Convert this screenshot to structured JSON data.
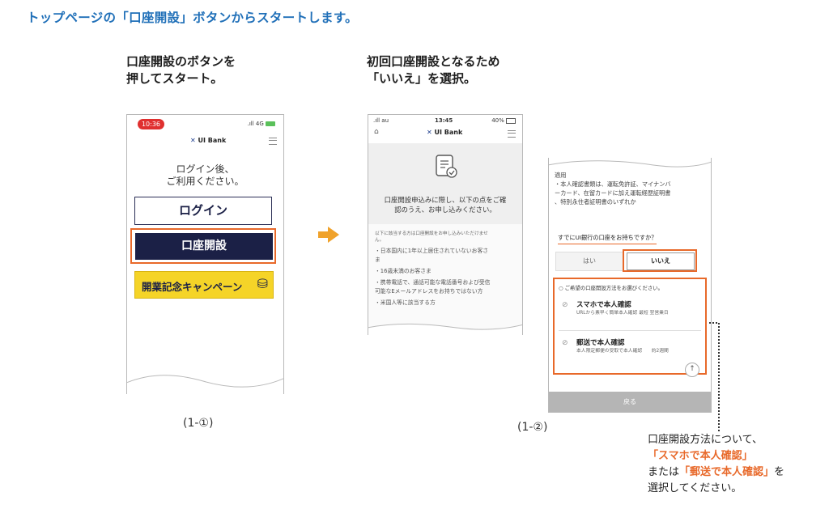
{
  "heading": "トップページの「口座開設」ボタンからスタートします。",
  "step1": {
    "caption_line1": "口座開設のボタンを",
    "caption_line2": "押してスタート。",
    "label": "(1-①)",
    "phone": {
      "time": "10:36",
      "signal": ".ıll 4G",
      "brand": "UI Bank",
      "greeting_line1": "ログイン後、",
      "greeting_line2": "ご利用ください。",
      "login_label": "ログイン",
      "open_account_label": "口座開設",
      "campaign_label": "開業記念キャンペーン"
    }
  },
  "step2": {
    "caption_line1": "初回口座開設となるため",
    "caption_line2": "「いいえ」を選択。",
    "label": "(1-②)",
    "phone_a": {
      "time": "13:45",
      "status_left": ".ıll au",
      "status_right": "40%",
      "brand": "UI Bank",
      "intro_line1": "口座開設申込みに際し、以下の点をご確",
      "intro_line2": "認のうえ、お申し込みください。",
      "notice_intro": "以下に該当する方は口座開設をお申し込みいただけませ",
      "notice_intro2": "ん。",
      "items": [
        "・日本国内に1年以上居住されていないお客さ",
        "ま",
        "・16歳未満のお客さま",
        "・携帯電話で、通話可能な電話番号および受信",
        "可能なEメールアドレスをお持ちではない方",
        "・米国人等に該当する方"
      ]
    },
    "phone_b": {
      "text_top1": "適用",
      "text_top2": "・本人確認書類は、運転免許証、マイナンバ",
      "text_top3": "ーカード、在留カードに加え運転経歴証明書",
      "text_top4": "、特別永住者証明書のいずれか",
      "question": "すでにUI銀行の口座をお持ちですか？",
      "yes_label": "はい",
      "no_label": "いいえ",
      "method_prompt": "ご希望の口座開設方法をお選びください。",
      "options": [
        {
          "title": "スマホで本人確認",
          "desc": "URLから素早く簡単本人確認 最短 翌営業日"
        },
        {
          "title": "郵送で本人確認",
          "desc": "本人限定郵便の受取で本人確認　　約2週間"
        }
      ],
      "back_label": "戻る"
    }
  },
  "note": {
    "line1": "口座開設方法について、",
    "line2": "「スマホで本人確認」",
    "line3_prefix": "または",
    "line3_highlight": "「郵送で本人確認」",
    "line3_suffix": "を",
    "line4": "選択してください。"
  },
  "colors": {
    "heading": "#1f6fb8",
    "highlight": "#e8692a",
    "navy": "#1b2046",
    "arrow": "#f0a22b",
    "campaign": "#f5d428"
  }
}
